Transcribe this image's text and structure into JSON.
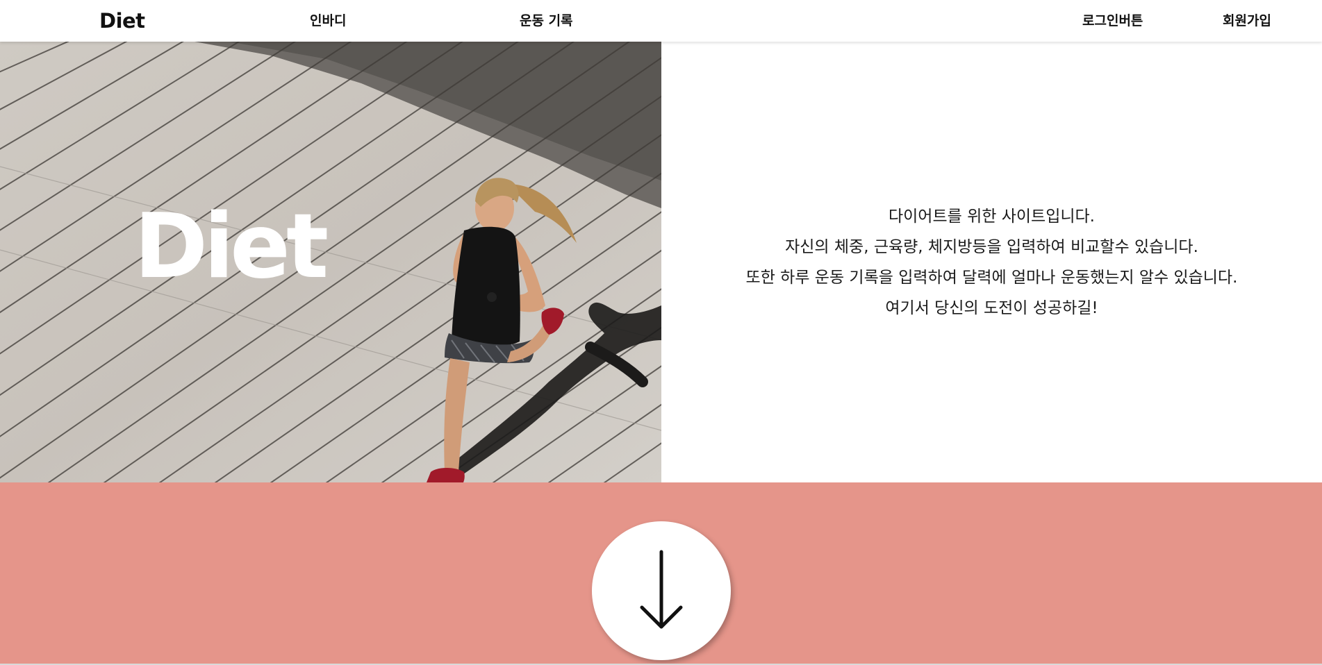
{
  "nav": {
    "logo": "Diet",
    "inbody": "인바디",
    "exercise_record": "운동 기록",
    "login": "로그인버튼",
    "signup": "회원가입"
  },
  "hero": {
    "title": "Diet",
    "lines": [
      "다이어트를 위한 사이트입니다.",
      "자신의 체중, 근육량, 체지방등을 입력하여 비교할수 있습니다.",
      "또한 하루 운동 기록을 입력하여 달력에 얼마나 운동했는지 알수 있습니다.",
      "여기서 당신의 도전이 성공하길!"
    ]
  },
  "scroll_button": {
    "icon": "arrow-down-icon"
  },
  "colors": {
    "band": "#e5958a",
    "header_bg": "#ffffff",
    "text": "#111111"
  }
}
